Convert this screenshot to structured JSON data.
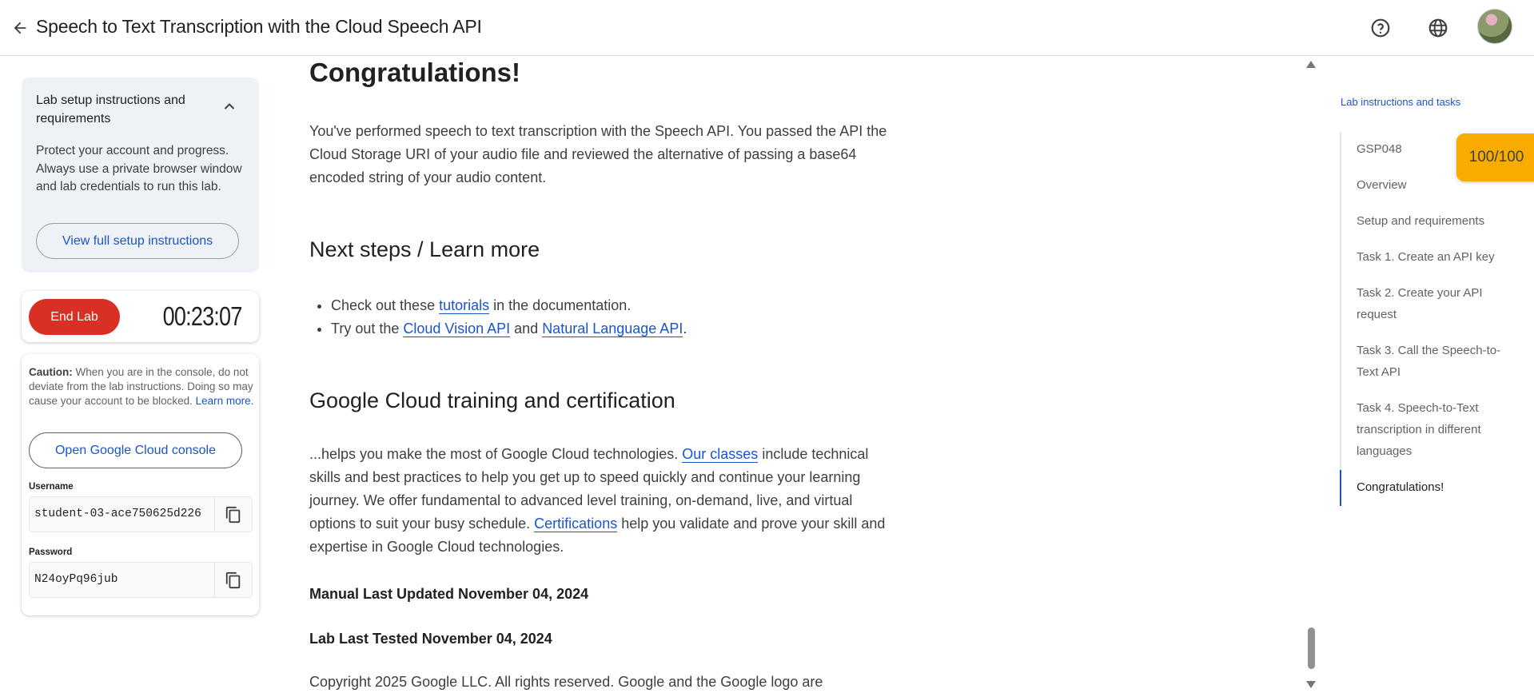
{
  "header": {
    "title": "Speech to Text Transcription with the Cloud Speech API",
    "back_icon": "arrow-left-icon",
    "help_icon": "help-circle-icon",
    "language_icon": "globe-icon"
  },
  "setup": {
    "title": "Lab setup instructions and requirements",
    "body": "Protect your account and progress. Always use a private browser window and lab credentials to run this lab.",
    "view_button": "View full setup instructions"
  },
  "timer": {
    "end_button": "End Lab",
    "time": "00:23:07"
  },
  "credentials": {
    "caution_label": "Caution:",
    "caution_text": " When you are in the console, do not deviate from the lab instructions. Doing so may cause your account to be blocked. ",
    "learn_more": "Learn more.",
    "console_button": "Open Google Cloud console",
    "username_label": "Username",
    "username_value": "student-03-ace750625d226",
    "password_label": "Password",
    "password_value": "N24oyPq96jub"
  },
  "content": {
    "heading": "Congratulations!",
    "intro": "You've performed speech to text transcription with the Speech API. You passed the API the Cloud Storage URI of your audio file and reviewed the alternative of passing a base64 encoded string of your audio content.",
    "next_steps_heading": "Next steps / Learn more",
    "step1_pre": "Check out these ",
    "step1_link": "tutorials",
    "step1_post": " in the documentation.",
    "step2_pre": "Try out the ",
    "step2_link1": "Cloud Vision API",
    "step2_mid": " and ",
    "step2_link2": "Natural Language API",
    "step2_post": ".",
    "training_heading": "Google Cloud training and certification",
    "training_p1": "...helps you make the most of Google Cloud technologies. ",
    "training_link1": "Our classes",
    "training_p2": " include technical skills and best practices to help you get up to speed quickly and continue your learning journey. We offer fundamental to advanced level training, on-demand, live, and virtual options to suit your busy schedule. ",
    "training_link2": "Certifications",
    "training_p3": " help you validate and prove your skill and expertise in Google Cloud technologies.",
    "manual_updated": "Manual Last Updated November 04, 2024",
    "lab_tested": "Lab Last Tested November 04, 2024",
    "copyright": "Copyright 2025 Google LLC. All rights reserved. Google and the Google logo are"
  },
  "toc": {
    "title": "Lab instructions and tasks",
    "items": [
      "GSP048",
      "Overview",
      "Setup and requirements",
      "Task 1. Create an API key",
      "Task 2. Create your API request",
      "Task 3. Call the Speech-to-Text API",
      "Task 4. Speech-to-Text transcription in different languages",
      "Congratulations!"
    ],
    "active_index": 7
  },
  "score": "100/100",
  "colors": {
    "accent": "#1a55c8",
    "end_lab": "#d93025",
    "score_badge": "#f9ab00"
  }
}
